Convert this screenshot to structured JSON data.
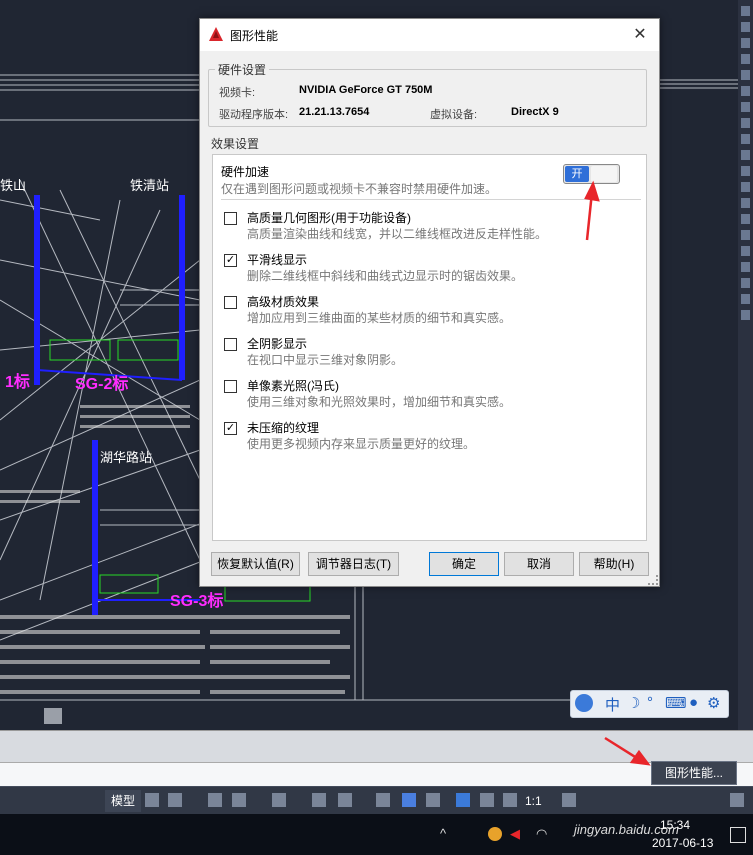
{
  "dialog": {
    "title": "图形性能",
    "hardware_group": "硬件设置",
    "video_card_label": "视频卡:",
    "video_card_value": "NVIDIA GeForce GT 750M",
    "driver_label": "驱动程序版本:",
    "driver_value": "21.21.13.7654",
    "virtual_device_label": "虚拟设备:",
    "virtual_device_value": "DirectX 9",
    "effect_group": "效果设置",
    "hw_accel_title": "硬件加速",
    "hw_accel_desc": "仅在遇到图形问题或视频卡不兼容时禁用硬件加速。",
    "hw_accel_toggle": "开",
    "options": [
      {
        "title": "高质量几何图形(用于功能设备)",
        "desc": "高质量渲染曲线和线宽，并以二维线框改进反走样性能。",
        "checked": false
      },
      {
        "title": "平滑线显示",
        "desc": "删除二维线框中斜线和曲线式边显示时的锯齿效果。",
        "checked": true
      },
      {
        "title": "高级材质效果",
        "desc": "增加应用到三维曲面的某些材质的细节和真实感。",
        "checked": false
      },
      {
        "title": "全阴影显示",
        "desc": "在视口中显示三维对象阴影。",
        "checked": false
      },
      {
        "title": "单像素光照(冯氏)",
        "desc": "使用三维对象和光照效果时，增加细节和真实感。",
        "checked": false
      },
      {
        "title": "未压缩的纹理",
        "desc": "使用更多视频内存来显示质量更好的纹理。",
        "checked": true
      }
    ],
    "check_mark": "✓",
    "buttons": {
      "reset": "恢复默认值(R)",
      "tuner_log": "调节器日志(T)",
      "ok": "确定",
      "cancel": "取消",
      "help": "帮助(H)"
    }
  },
  "cad": {
    "labels": [
      "铁山",
      "铁清站",
      "1标",
      "SG-2标",
      "湖华路站",
      "SG-3标"
    ]
  },
  "status": {
    "model": "模型",
    "scale": "1:1",
    "gfx_button": "图形性能..."
  },
  "taskbar": {
    "time": "15:34",
    "date": "2017-06-13",
    "watermark": "jingyan.baidu.com"
  },
  "ime": {
    "mode": "中"
  },
  "colors": {
    "accent": "#2f6fd8",
    "annotation": "#e8262b",
    "cad_magenta": "#ff2cff",
    "cad_blue": "#1f1fff"
  }
}
